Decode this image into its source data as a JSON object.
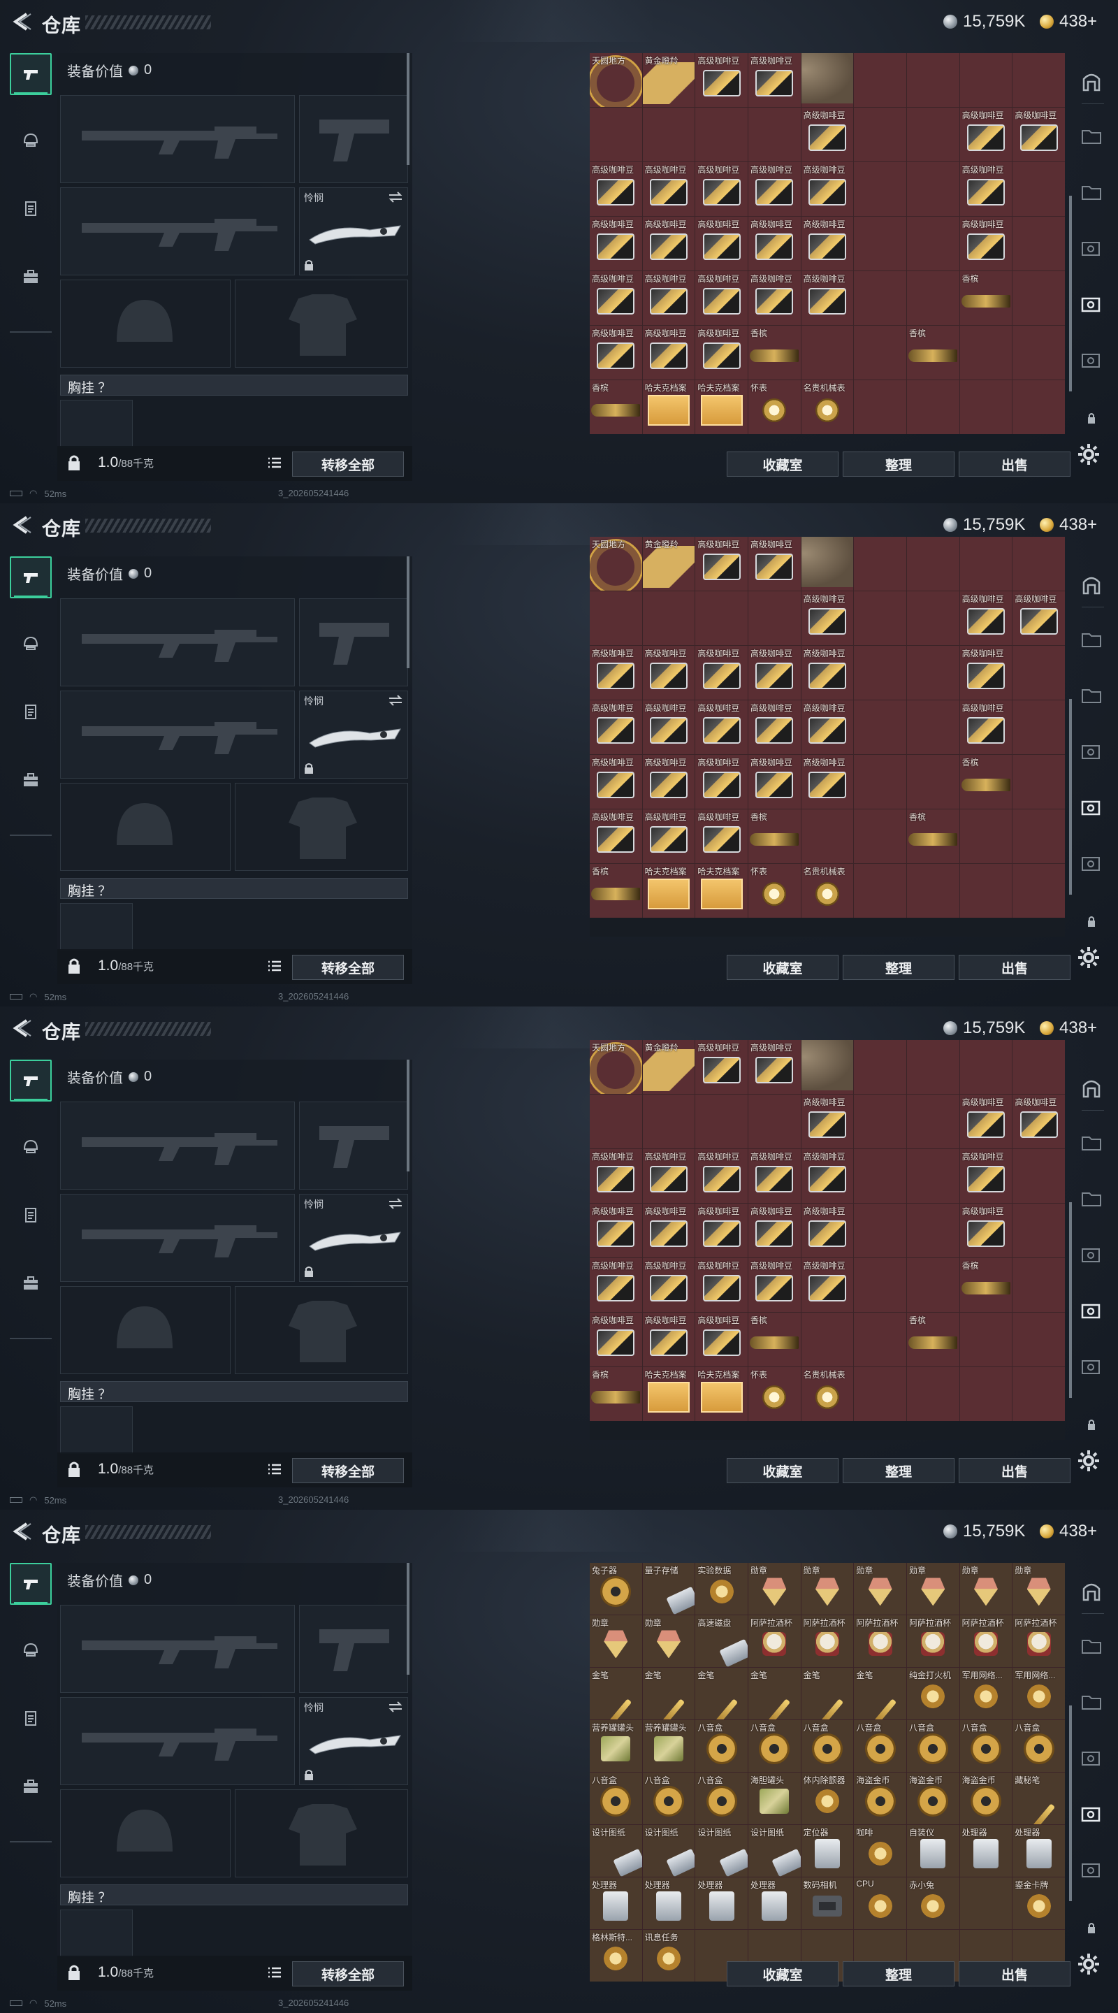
{
  "header": {
    "title": "仓库",
    "currency_silver": "15,759K",
    "currency_gold": "438+"
  },
  "equipment": {
    "value_label": "装备价值",
    "value_amount": "0",
    "melee_label": "怜悯",
    "chest_label": "胸挂 ？",
    "weight_value": "1.0",
    "weight_max": "/88千克",
    "transfer_all": "转移全部"
  },
  "storage_buttons": {
    "collection": "收藏室",
    "sort": "整理",
    "sell": "出售"
  },
  "status": {
    "ping": "52ms",
    "build": "3_202605241446"
  },
  "frames": [
    {
      "cells": [
        {
          "label": "天圆地方",
          "art": "armillary",
          "span": 1,
          "rows": 1
        },
        {
          "label": "黄金瞪羚",
          "art": "deer"
        },
        {
          "label": "高级咖啡豆",
          "art": "coffee-tall"
        },
        {
          "label": "高级咖啡豆",
          "art": "coffee-tall"
        },
        {
          "label": "",
          "art": "bust"
        },
        {
          "label": "",
          "art": ""
        },
        {
          "label": "",
          "art": ""
        },
        {
          "label": "",
          "art": ""
        },
        {
          "label": "",
          "art": ""
        }
      ]
    }
  ],
  "grid_a_labels": [
    [
      "天圆地方",
      "黄金瞪羚",
      "高级咖啡豆",
      "高级咖啡豆",
      "",
      "",
      "",
      "",
      ""
    ],
    [
      "",
      "",
      "",
      "",
      "高级咖啡豆",
      "",
      "",
      "高级咖啡豆",
      "高级咖啡豆"
    ],
    [
      "高级咖啡豆",
      "高级咖啡豆",
      "高级咖啡豆",
      "高级咖啡豆",
      "高级咖啡豆",
      "",
      "",
      "高级咖啡豆",
      ""
    ],
    [
      "高级咖啡豆",
      "高级咖啡豆",
      "高级咖啡豆",
      "高级咖啡豆",
      "高级咖啡豆",
      "",
      "",
      "高级咖啡豆",
      ""
    ],
    [
      "高级咖啡豆",
      "高级咖啡豆",
      "高级咖啡豆",
      "高级咖啡豆",
      "高级咖啡豆",
      "",
      "",
      "香槟",
      ""
    ],
    [
      "高级咖啡豆",
      "高级咖啡豆",
      "高级咖啡豆",
      "香槟",
      "",
      "",
      "香槟",
      "",
      ""
    ],
    [
      "香槟",
      "哈夫克档案",
      "哈夫克档案",
      "怀表",
      "名贵机械表",
      "",
      "",
      "",
      ""
    ]
  ],
  "grid_b_labels": [
    [
      "兔子器",
      "量子存储",
      "实验数据",
      "勋章",
      "勋章",
      "勋章",
      "勋章",
      "勋章",
      "勋章"
    ],
    [
      "勋章",
      "勋章",
      "高速磁盘",
      "阿萨拉酒杯",
      "阿萨拉酒杯",
      "阿萨拉酒杯",
      "阿萨拉酒杯",
      "阿萨拉酒杯",
      "阿萨拉酒杯"
    ],
    [
      "金笔",
      "金笔",
      "金笔",
      "金笔",
      "金笔",
      "金笔",
      "纯金打火机",
      "军用网络...",
      "军用网络..."
    ],
    [
      "营养罐罐头",
      "营养罐罐头",
      "八音盒",
      "八音盒",
      "八音盒",
      "八音盒",
      "八音盒",
      "八音盒",
      "八音盒"
    ],
    [
      "八音盒",
      "八音盒",
      "八音盒",
      "海胆罐头",
      "体内除颤器",
      "海盗金币",
      "海盗金币",
      "海盗金币",
      "藏秘笔"
    ],
    [
      "设计图纸",
      "设计图纸",
      "设计图纸",
      "设计图纸",
      "定位器",
      "咖啡",
      "自装仪",
      "处理器",
      "处理器"
    ],
    [
      "处理器",
      "处理器",
      "处理器",
      "处理器",
      "数码相机",
      "CPU",
      "赤小兔",
      "",
      "鎏金卡牌"
    ],
    [
      "格林斯特...",
      "讯息任务",
      "",
      "",
      "",
      "",
      "",
      "",
      ""
    ]
  ]
}
